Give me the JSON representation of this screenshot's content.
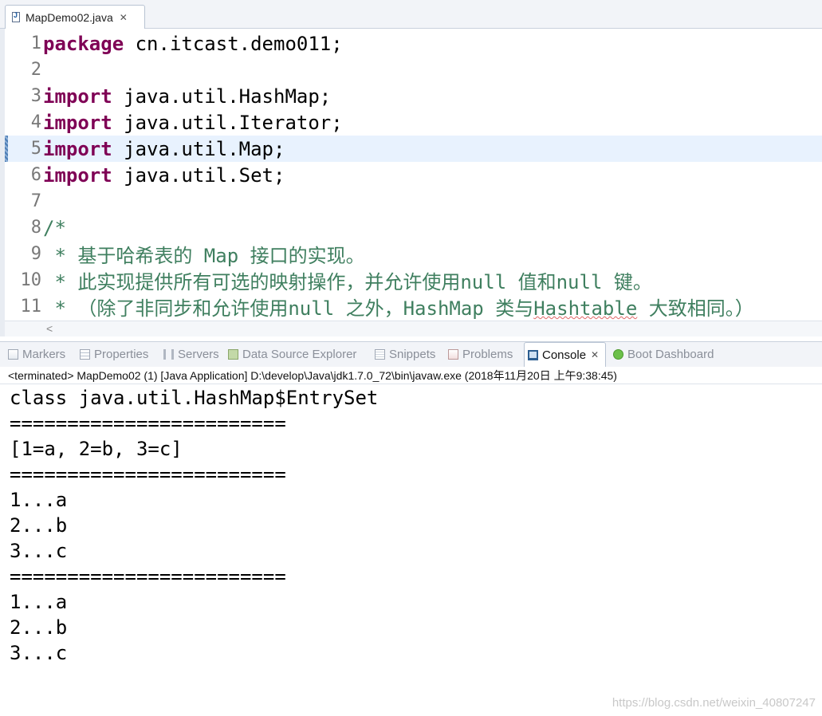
{
  "editor": {
    "tab_title": "MapDemo02.java",
    "tab_close": "✕",
    "lines": [
      {
        "n": "1",
        "kw": "package",
        "text": " cn.itcast.demo011;"
      },
      {
        "n": "2",
        "kw": "",
        "text": ""
      },
      {
        "n": "3",
        "kw": "import",
        "text": " java.util.HashMap;"
      },
      {
        "n": "4",
        "kw": "import",
        "text": " java.util.Iterator;"
      },
      {
        "n": "5",
        "kw": "import",
        "text": " java.util.Map;"
      },
      {
        "n": "6",
        "kw": "import",
        "text": " java.util.Set;"
      },
      {
        "n": "7",
        "kw": "",
        "text": ""
      },
      {
        "n": "8",
        "comment": "/*"
      },
      {
        "n": "9",
        "comment_parts": [
          " * 基于哈希表的 ",
          "Map",
          " 接口的实现。"
        ]
      },
      {
        "n": "10",
        "comment_parts": [
          " * 此实现提供所有可选的映射操作，并允许使用",
          "null",
          " 值和",
          "null",
          " 键。"
        ]
      },
      {
        "n": "11",
        "comment_parts": [
          " * （除了非同步和允许使用",
          "null",
          " 之外，",
          "HashMap",
          " 类与",
          "Hashtable",
          " 大致相同。）"
        ]
      }
    ],
    "current_line": "5",
    "scroll_left_arrow": "<"
  },
  "views": {
    "tabs": [
      {
        "label": "Markers",
        "icon": "markers-icon"
      },
      {
        "label": "Properties",
        "icon": "properties-icon"
      },
      {
        "label": "Servers",
        "icon": "servers-icon"
      },
      {
        "label": "Data Source Explorer",
        "icon": "database-icon"
      },
      {
        "label": "Snippets",
        "icon": "snippets-icon"
      },
      {
        "label": "Problems",
        "icon": "problems-icon"
      },
      {
        "label": "Console",
        "icon": "console-icon",
        "active": true,
        "close": "✕"
      },
      {
        "label": "Boot Dashboard",
        "icon": "boot-dashboard-icon"
      }
    ]
  },
  "console": {
    "status": "<terminated> MapDemo02 (1) [Java Application] D:\\develop\\Java\\jdk1.7.0_72\\bin\\javaw.exe (2018年11月20日 上午9:38:45)",
    "output": [
      "class java.util.HashMap$EntrySet",
      "========================",
      "[1=a, 2=b, 3=c]",
      "========================",
      "1...a",
      "2...b",
      "3...c",
      "========================",
      "1...a",
      "2...b",
      "3...c"
    ]
  },
  "watermark": "https://blog.csdn.net/weixin_40807247"
}
